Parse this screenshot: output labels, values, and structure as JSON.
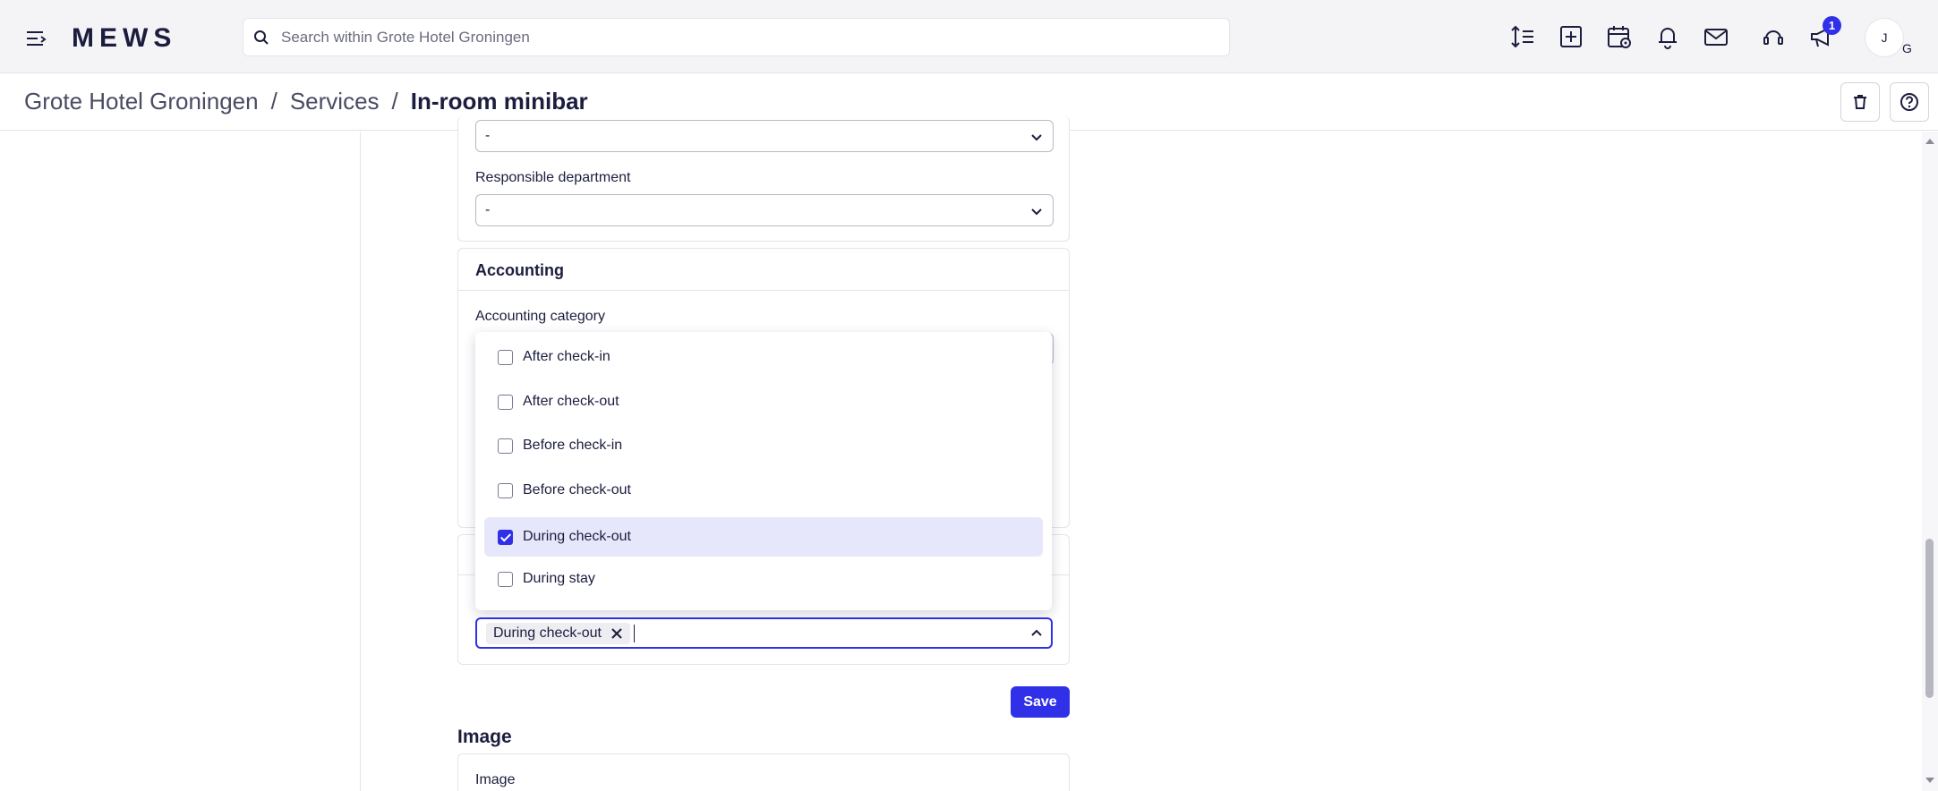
{
  "app": {
    "logo": "MEWS"
  },
  "search": {
    "placeholder": "Search within Grote Hotel Groningen"
  },
  "notifications": {
    "badge_count": "1"
  },
  "user": {
    "avatar_initial": "J",
    "avatar_sub": "G"
  },
  "breadcrumb": {
    "items": [
      "Grote Hotel Groningen",
      "Services",
      "In-room minibar"
    ],
    "separator": "/"
  },
  "form": {
    "first_select_value": "-",
    "responsible_department": {
      "label": "Responsible department",
      "value": "-"
    },
    "accounting": {
      "title": "Accounting",
      "category_label": "Accounting category"
    }
  },
  "dropdown": {
    "options": [
      {
        "label": "After check-in",
        "checked": false
      },
      {
        "label": "After check-out",
        "checked": false
      },
      {
        "label": "Before check-in",
        "checked": false
      },
      {
        "label": "Before check-out",
        "checked": false
      },
      {
        "label": "During check-out",
        "checked": true
      },
      {
        "label": "During stay",
        "checked": false
      }
    ]
  },
  "multiselect": {
    "chip": "During check-out"
  },
  "actions": {
    "save_label": "Save"
  },
  "image_section": {
    "title": "Image",
    "field_label": "Image"
  },
  "colors": {
    "accent": "#3030e8",
    "selected_bg": "#e7e7fb"
  }
}
